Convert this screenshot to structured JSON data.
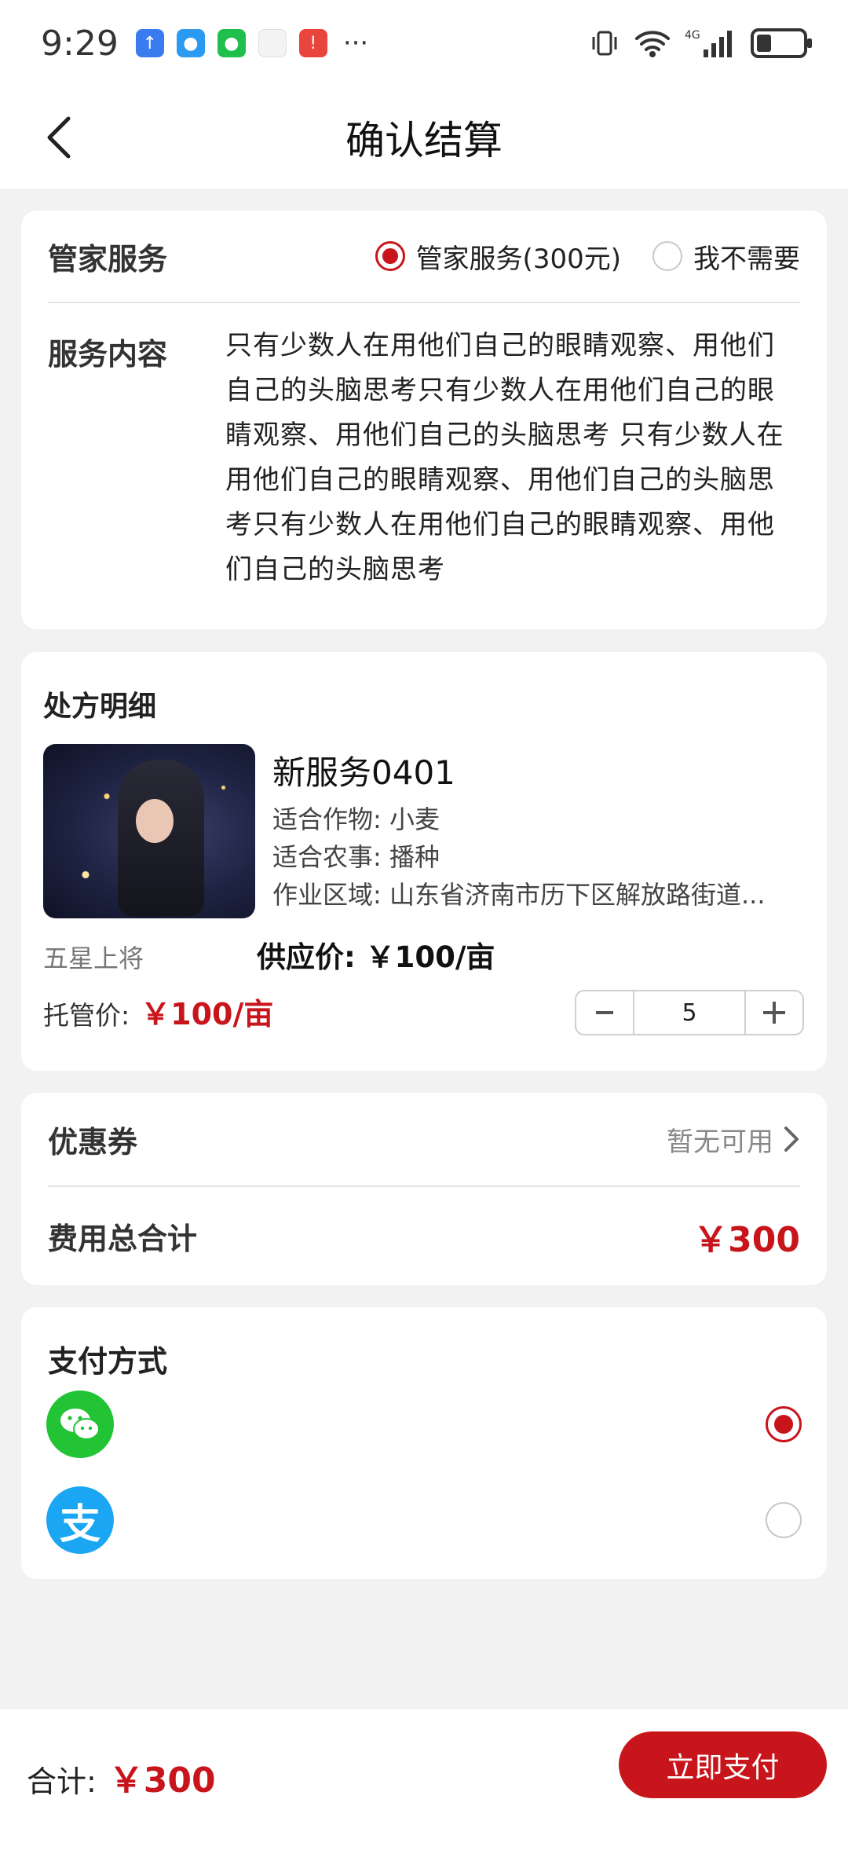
{
  "status_bar": {
    "time": "9:29",
    "more": "···",
    "network": "4G"
  },
  "header": {
    "title": "确认结算"
  },
  "service": {
    "label": "管家服务",
    "options": [
      "管家服务(300元)",
      "我不需要"
    ],
    "selected_index": 0,
    "content_label": "服务内容",
    "content_text": "只有少数人在用他们自己的眼睛观察、用他们自己的头脑思考只有少数人在用他们自己的眼睛观察、用他们自己的头脑思考 只有少数人在用他们自己的眼睛观察、用他们自己的头脑思考只有少数人在用他们自己的眼睛观察、用他们自己的头脑思考"
  },
  "prescription": {
    "title": "处方明细",
    "item": {
      "name": "新服务0401",
      "crop_label": "适合作物:",
      "crop": "小麦",
      "task_label": "适合农事:",
      "task": "播种",
      "area_label": "作业区域:",
      "area": "山东省济南市历下区解放路街道...",
      "grade": "五星上将",
      "supply_label": "供应价:",
      "supply_price": "￥100/亩",
      "hosting_label": "托管价:",
      "hosting_price": "￥100/亩",
      "quantity": "5"
    }
  },
  "summary": {
    "coupon_label": "优惠券",
    "coupon_value": "暂无可用",
    "total_label": "费用总合计",
    "total_value": "￥300"
  },
  "payment": {
    "title": "支付方式",
    "methods": [
      {
        "icon": "wechat-pay-icon",
        "selected": true
      },
      {
        "icon": "alipay-icon",
        "selected": false,
        "glyph": "支"
      }
    ]
  },
  "footer": {
    "total_label": "合计:",
    "total_value": "￥300",
    "pay_button": "立即支付"
  },
  "colors": {
    "accent": "#c8151b",
    "wechat": "#22c335",
    "alipay": "#1aa6f2"
  }
}
